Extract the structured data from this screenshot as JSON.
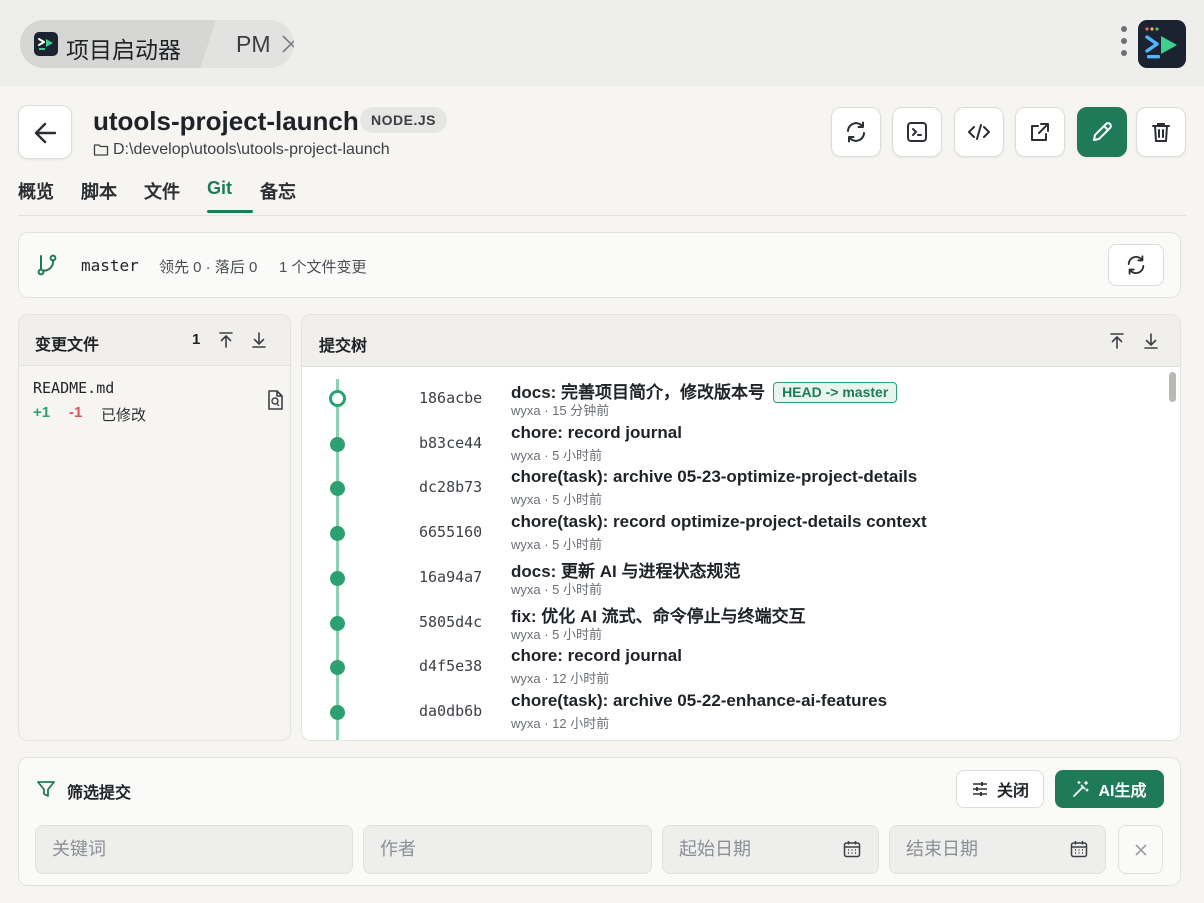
{
  "window": {
    "app_tab_label": "项目启动器",
    "second_tab_label": "PM"
  },
  "project": {
    "name": "utools-project-launch",
    "runtime_badge": "NODE.JS",
    "path": "D:\\develop\\utools\\utools-project-launch"
  },
  "actions": [
    "refresh-icon",
    "terminal-icon",
    "code-icon",
    "external-link-icon",
    "edit-icon",
    "trash-icon"
  ],
  "nav": {
    "tabs": [
      {
        "label": "概览"
      },
      {
        "label": "脚本"
      },
      {
        "label": "文件"
      },
      {
        "label": "Git"
      },
      {
        "label": "备忘"
      }
    ],
    "active": "Git"
  },
  "branch": {
    "name": "master",
    "ahead_behind": "领先 0 · 落后 0",
    "changes_summary": "1 个文件变更"
  },
  "changes": {
    "title": "变更文件",
    "count": "1",
    "files": [
      {
        "name": "README.md",
        "added": "+1",
        "removed": "-1",
        "status": "已修改"
      }
    ]
  },
  "commit_tree": {
    "title": "提交树",
    "commits": [
      {
        "hash": "186acbe",
        "message": "docs: 完善项目简介，修改版本号",
        "ref": "HEAD -> master",
        "meta": "wyxa · 15 分钟前",
        "head": true
      },
      {
        "hash": "b83ce44",
        "message": "chore: record journal",
        "meta": "wyxa · 5 小时前"
      },
      {
        "hash": "dc28b73",
        "message": "chore(task): archive 05-23-optimize-project-details",
        "meta": "wyxa · 5 小时前"
      },
      {
        "hash": "6655160",
        "message": "chore(task): record optimize-project-details context",
        "meta": "wyxa · 5 小时前"
      },
      {
        "hash": "16a94a7",
        "message": "docs: 更新 AI 与进程状态规范",
        "meta": "wyxa · 5 小时前"
      },
      {
        "hash": "5805d4c",
        "message": "fix: 优化 AI 流式、命令停止与终端交互",
        "meta": "wyxa · 5 小时前"
      },
      {
        "hash": "d4f5e38",
        "message": "chore: record journal",
        "meta": "wyxa · 12 小时前"
      },
      {
        "hash": "da0db6b",
        "message": "chore(task): archive 05-22-enhance-ai-features",
        "meta": "wyxa · 12 小时前"
      }
    ]
  },
  "filter": {
    "title": "筛选提交",
    "close_label": "关闭",
    "ai_label": "AI生成",
    "keyword_placeholder": "关键词",
    "author_placeholder": "作者",
    "start_date_placeholder": "起始日期",
    "end_date_placeholder": "结束日期"
  },
  "colors": {
    "accent": "#1f7a5a",
    "graph": "#2da072",
    "added": "#2da072",
    "removed": "#d9534f"
  }
}
